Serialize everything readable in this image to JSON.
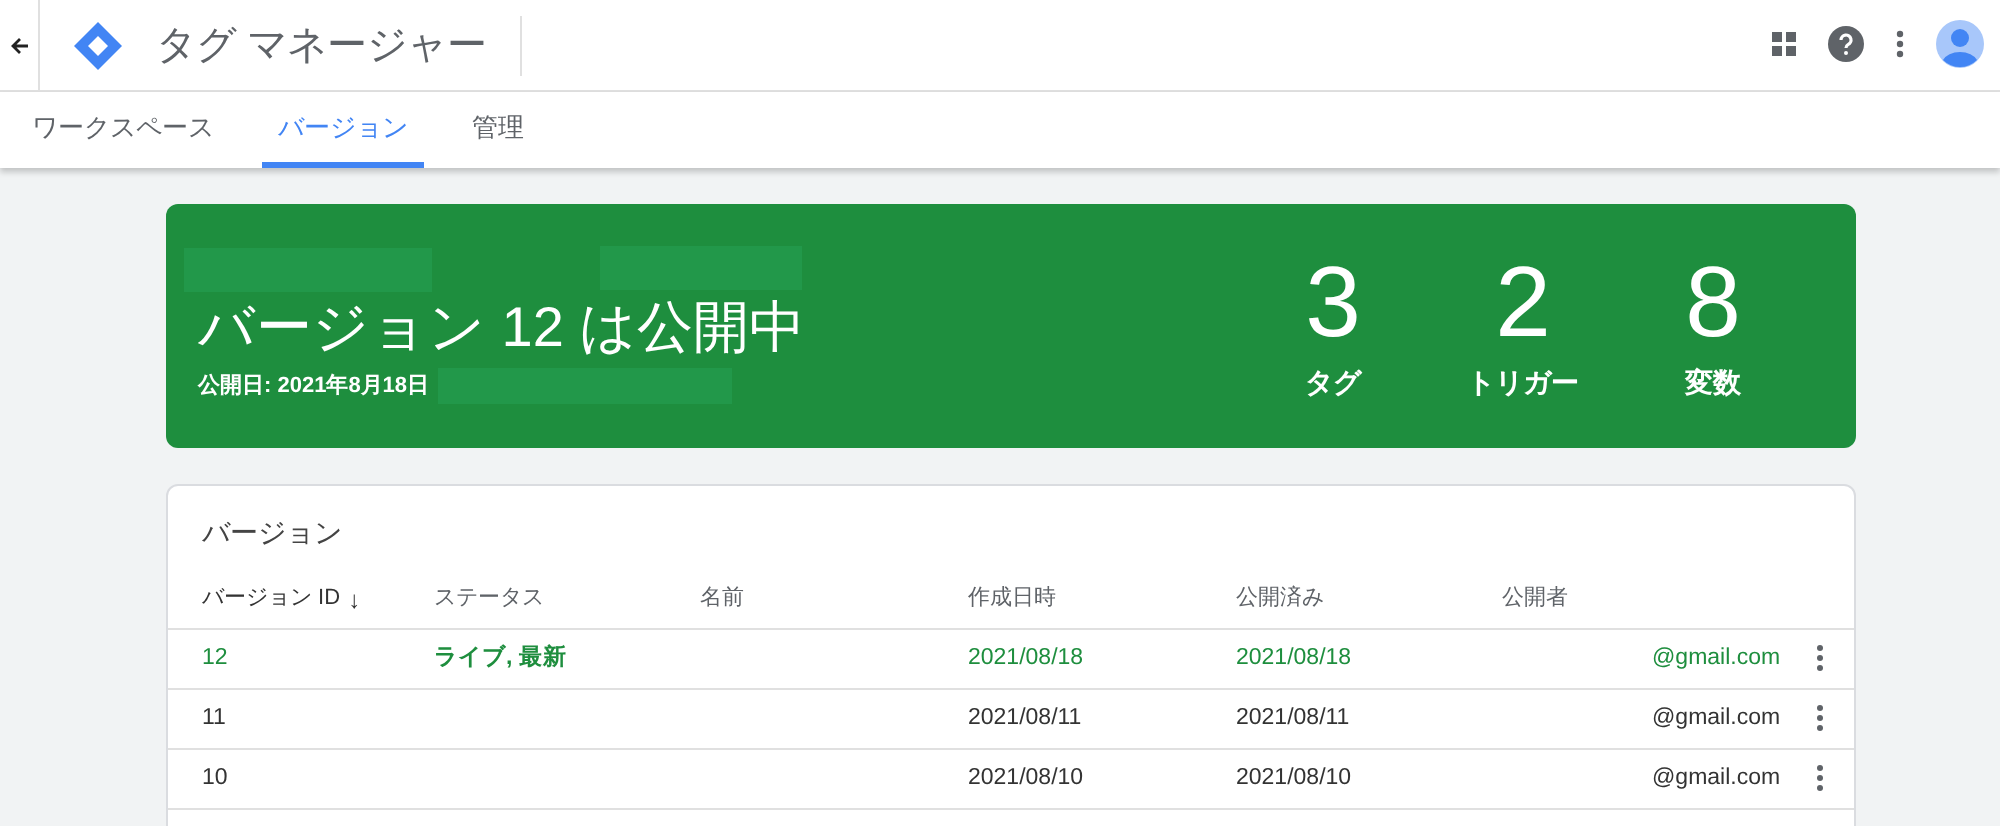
{
  "header": {
    "title": "タグ マネージャー"
  },
  "tabs": [
    {
      "label": "ワークスペース",
      "selected": false
    },
    {
      "label": "バージョン",
      "selected": true
    },
    {
      "label": "管理",
      "selected": false
    }
  ],
  "banner": {
    "headline": "バージョン 12 は公開中",
    "published": "公開日: 2021年8月18日",
    "stats": [
      {
        "value": "3",
        "label": "タグ"
      },
      {
        "value": "2",
        "label": "トリガー"
      },
      {
        "value": "8",
        "label": "変数"
      }
    ]
  },
  "versions": {
    "title": "バージョン",
    "columns": [
      "バージョン ID",
      "ステータス",
      "名前",
      "作成日時",
      "公開済み",
      "公開者"
    ],
    "sort_icon": "↓",
    "rows": [
      {
        "id": "12",
        "status": "ライブ, 最新",
        "created": "2021/08/18",
        "published": "2021/08/18",
        "publisher": "@gmail.com",
        "live": true
      },
      {
        "id": "11",
        "status": "",
        "created": "2021/08/11",
        "published": "2021/08/11",
        "publisher": "@gmail.com",
        "live": false
      },
      {
        "id": "10",
        "status": "",
        "created": "2021/08/10",
        "published": "2021/08/10",
        "publisher": "@gmail.com",
        "live": false
      }
    ]
  }
}
